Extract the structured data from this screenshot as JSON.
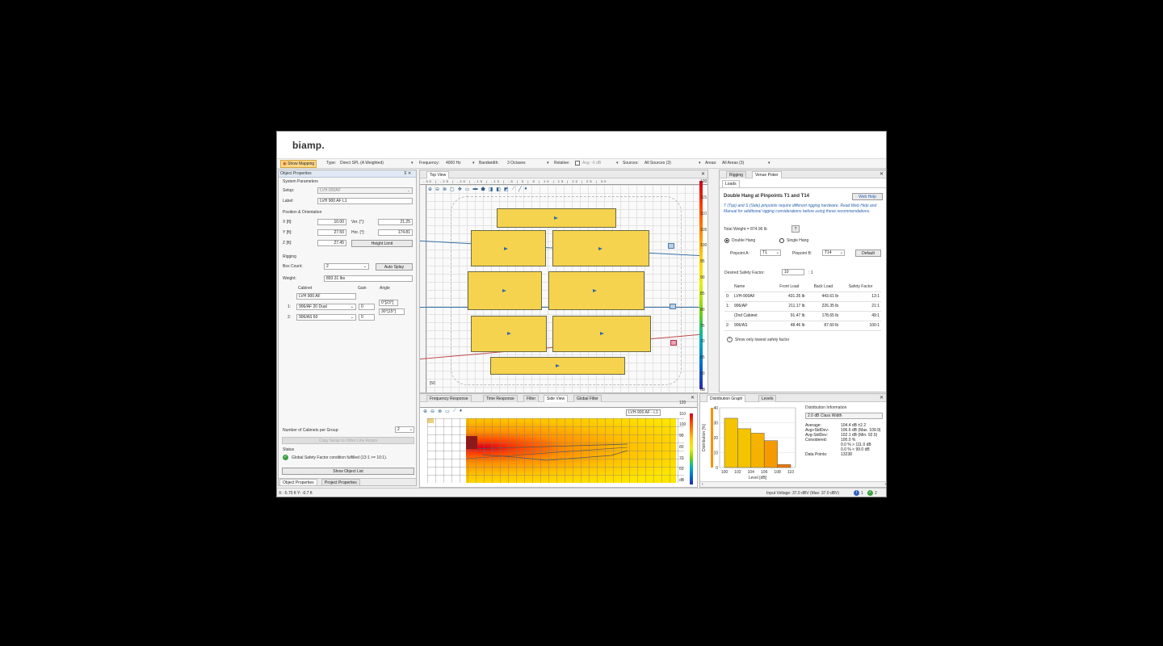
{
  "app": {
    "logo": "biamp."
  },
  "toolbar": {
    "show_mapping": "Show Mapping",
    "type_label": "Type:",
    "type_value": "Direct SPL (A Weighted)",
    "frequency_label": "Frequency:",
    "frequency_value": "4000 Hz",
    "bandwidth_label": "Bandwidth:",
    "bandwidth_value": "3 Octaves",
    "relative_label": "Relative:",
    "avg_value": "Avg: -6 dB",
    "sources_label": "Sources:",
    "sources_value": "All Sources (3)",
    "areas_label": "Areas:",
    "areas_value": "All Areas (3)"
  },
  "object_properties": {
    "title": "Object Properties",
    "pin": "⊼ ✕",
    "system_parameters": "System Parameters",
    "setup_label": "Setup:",
    "setup_value": "LVH-900AF",
    "label_label": "Label:",
    "label_value": "LVH 900 AF L1",
    "position_section": "Position & Orientation",
    "x_label": "X [ft]:",
    "x_value": "10.00",
    "y_label": "Y [ft]:",
    "y_value": "27.50",
    "z_label": "Z [ft]:",
    "z_value": "27.45",
    "ver_label": "Ver. [°]:",
    "ver_value": "21.25",
    "hor_label": "Hor. [°]:",
    "hor_value": "174.81",
    "height_limit": "Height Limit",
    "rigging_section": "Rigging",
    "box_count_label": "Box Count:",
    "box_count_value": "2",
    "auto_splay": "Auto Splay",
    "weight_label": "Weight:",
    "weight_value": "893.31 lbs",
    "col_cabinet": "Cabinet",
    "col_gain": "Gain",
    "col_angle": "Angle",
    "cabinet_head": "LVH 900 AF",
    "angle_head": "0°[23°]",
    "rows": [
      {
        "idx": "1:",
        "cabinet": "906/AF 20 Dual",
        "gain": "0",
        "angle": "30°[15°]"
      },
      {
        "idx": "2:",
        "cabinet": "906/AS 60",
        "gain": "0",
        "angle": ""
      }
    ],
    "num_groups_label": "Number of Cabinets per Group:",
    "num_groups_value": "2",
    "copy_button": "Copy Setup to Other Line Arrays",
    "status_label": "Status",
    "status_text": "Global Safety Factor condition fulfilled (13:1 >= 10:1).",
    "show_object_list": "Show Object List",
    "tab_object": "Object Properties",
    "tab_project": "Project Properties"
  },
  "top_view": {
    "tab": "Top View",
    "ruler": "-30 | -25 | -20 | -15 | -10 | -5 | 0 | 5 | 10 | 15 | 20 | 25 | 30",
    "coord": "|50"
  },
  "bottom_tabs": {
    "items": [
      "Frequency Response",
      "Time Response",
      "Filter",
      "Side View",
      "Global Filter"
    ],
    "active": 3,
    "source_label": "LVH-900 AF - L1"
  },
  "side_scale": [
    "120",
    "110",
    "100",
    "90",
    "80",
    "70",
    "60",
    "dB"
  ],
  "top_scale": [
    "120",
    "115",
    "110",
    "105",
    "100",
    "95",
    "90",
    "85",
    "80",
    "75",
    "70",
    "65",
    "60",
    "dB"
  ],
  "rigging": {
    "tab_rigging": "Rigging",
    "tab_venue": "Venue Poker",
    "subtab": "Loads",
    "title": "Double Hang at Pinpoints T1 and T14",
    "web_help": "Web Help",
    "note": "T (Top) and S (Side) pinpoints require different rigging hardware. Read Web Help and Manual for additional rigging considerations before using these recommendations.",
    "total_weight": "Total Weight = 874.96 lb",
    "help_q": "?",
    "double_hang": "Double Hang",
    "single_hang": "Single Hang",
    "pinpoint_a_label": "Pinpoint A:",
    "pinpoint_a": "T1",
    "pinpoint_b_label": "Pinpoint B:",
    "pinpoint_b": "T14",
    "default_btn": "Default",
    "safety_label": "Desired Safety Factor:",
    "safety_value": "10",
    "safety_suffix": ": 1",
    "columns": [
      "Name",
      "Front Load",
      "Back Load",
      "Safety Factor"
    ],
    "rows": [
      {
        "idx": "0:",
        "name": "LVH-900AF",
        "front": "431.35 lb",
        "back": "443.61 lb",
        "sf": "13:1"
      },
      {
        "idx": "1:",
        "name": "906/AP",
        "front": "211.17 lb",
        "back": "226.35 lb",
        "sf": "21:1"
      },
      {
        "idx": "",
        "name": "(2nd Cabinet",
        "front": "91.47 lb",
        "back": "178.65 lb",
        "sf": "49:1"
      },
      {
        "idx": "2:",
        "name": "906/AS",
        "front": "48.46 lb",
        "back": "87.60 lb",
        "sf": "100:1"
      }
    ],
    "show_lowest": "Show only lowest safety factor"
  },
  "distribution": {
    "tab_graph": "Distribution Graph",
    "tab_levels": "Levels",
    "info_title": "Distribution Information",
    "class_width": "2.0 dB Class Width",
    "stats": [
      {
        "k": "Average:",
        "v": "104.4 dB ±2.2"
      },
      {
        "k": "Avg+StdDev:",
        "v": "106.6 dB (Max. 109.9)"
      },
      {
        "k": "Avg-StdDev:",
        "v": "102.1 dB (Min. 92.5)"
      },
      {
        "k": "Considered:",
        "v": "100.0 %"
      },
      {
        "k": "",
        "v": "0.0 % > 111.0 dB"
      },
      {
        "k": "",
        "v": "0.0 % < 99.0 dB"
      },
      {
        "k": "Data Points:",
        "v": "13238"
      }
    ],
    "ylabel": "Distribution [%]",
    "xlabel": "Level [dB]",
    "y_ticks": [
      "40",
      "30",
      "20",
      "10",
      "0"
    ],
    "x_ticks": [
      "100",
      "102",
      "104",
      "106",
      "108",
      "110"
    ]
  },
  "chart_data": {
    "type": "bar",
    "categories": [
      "101",
      "103",
      "105",
      "107",
      "109"
    ],
    "values": [
      33,
      26,
      23,
      18,
      2
    ],
    "xlabel": "Level [dB]",
    "ylabel": "Distribution [%]",
    "ylim": [
      0,
      40
    ],
    "colors": [
      "#f5c400",
      "#f5c400",
      "#f5b300",
      "#f59a00",
      "#f07800"
    ]
  },
  "status": {
    "coords": "X: -5.75 ft Y: -0.7 ft",
    "input_voltage": "Input Voltage: 37.0 dBV (Max: 37.0 dBV)",
    "info_count": "1",
    "ok_count": "2"
  }
}
